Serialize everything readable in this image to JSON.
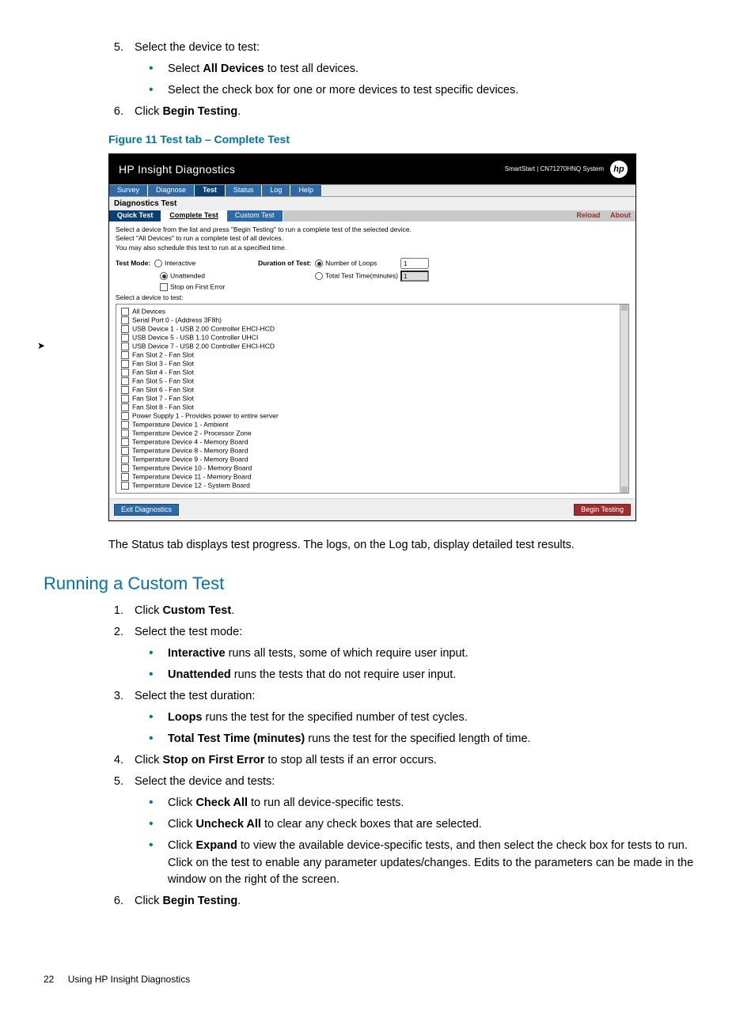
{
  "steps_top": {
    "s5": "Select the device to test:",
    "s5_b1_pre": "Select ",
    "s5_b1_bold": "All Devices",
    "s5_b1_post": " to test all devices.",
    "s5_b2": "Select the check box for one or more devices to test specific devices.",
    "s6_pre": "Click ",
    "s6_bold": "Begin Testing",
    "s6_post": "."
  },
  "figure_caption": "Figure 11 Test tab – Complete Test",
  "shot": {
    "title": "HP Insight Diagnostics",
    "sys": "SmartStart | CN71270HNQ System",
    "logo": "hp",
    "tabs": [
      "Survey",
      "Diagnose",
      "Test",
      "Status",
      "Log",
      "Help"
    ],
    "subtitle": "Diagnostics Test",
    "subtabs": [
      "Quick Test",
      "Complete Test",
      "Custom Test"
    ],
    "links": [
      "Reload",
      "About"
    ],
    "desc1": "Select a device from the list and press \"Begin Testing\" to run a complete test of the selected device.",
    "desc2": "Select \"All Devices\" to run a complete test of all devices.",
    "desc3": "You may also schedule this test to run at a specified time.",
    "testmode": "Test Mode:",
    "interactive": "Interactive",
    "unattended": "Unattended",
    "stop": "Stop on First Error",
    "duration": "Duration of Test:",
    "loops": "Number of Loops",
    "ttt": "Total Test Time(minutes)",
    "val1": "1",
    "val2": "1",
    "sel": "Select a device to test:",
    "devices": [
      "All Devices",
      "Serial Port 0 - (Address 3F8h)",
      "USB Device 1 - USB 2.00 Controller EHCI-HCD",
      "USB Device 5 - USB 1.10 Controller UHCI",
      "USB Device 7 - USB 2.00 Controller EHCI-HCD",
      "Fan Slot 2 - Fan Slot",
      "Fan Slot 3 - Fan Slot",
      "Fan Slot 4 - Fan Slot",
      "Fan Slot 5 - Fan Slot",
      "Fan Slot 6 - Fan Slot",
      "Fan Slot 7 - Fan Slot",
      "Fan Slot 8 - Fan Slot",
      "Power Supply 1 - Provides power to entire server",
      "Temperature Device 1 - Ambient",
      "Temperature Device 2 - Processor Zone",
      "Temperature Device 4 - Memory Board",
      "Temperature Device 8 - Memory Board",
      "Temperature Device 9 - Memory Board",
      "Temperature Device 10 - Memory Board",
      "Temperature Device 11 - Memory Board",
      "Temperature Device 12 - System Board"
    ],
    "exit": "Exit Diagnostics",
    "begin": "Begin Testing"
  },
  "after_figure": "The Status tab displays test progress. The logs, on the Log tab, display detailed test results.",
  "section2": "Running a Custom Test",
  "steps2": {
    "s1_pre": "Click ",
    "s1_bold": "Custom Test",
    "s1_post": ".",
    "s2": "Select the test mode:",
    "s2_b1_bold": "Interactive",
    "s2_b1_post": " runs all tests, some of which require user input.",
    "s2_b2_bold": "Unattended",
    "s2_b2_post": " runs the tests that do not require user input.",
    "s3": "Select the test duration:",
    "s3_b1_bold": "Loops",
    "s3_b1_post": " runs the test for the specified number of test cycles.",
    "s3_b2_bold": "Total Test Time (minutes)",
    "s3_b2_post": " runs the test for the specified length of time.",
    "s4_pre": "Click ",
    "s4_bold": "Stop on First Error",
    "s4_post": " to stop all tests if an error occurs.",
    "s5": "Select the device and tests:",
    "s5_b1_pre": "Click ",
    "s5_b1_bold": "Check All",
    "s5_b1_post": " to run all device-specific tests.",
    "s5_b2_pre": "Click ",
    "s5_b2_bold": "Uncheck All",
    "s5_b2_post": " to clear any check boxes that are selected.",
    "s5_b3_pre": "Click ",
    "s5_b3_bold": "Expand",
    "s5_b3_post": " to view the available device-specific tests, and then select the check box for tests to run. Click on the test to enable any parameter updates/changes. Edits to the parameters can be made in the window on the right of the screen.",
    "s6_pre": "Click ",
    "s6_bold": "Begin Testing",
    "s6_post": "."
  },
  "footer": {
    "page": "22",
    "title": "Using HP Insight Diagnostics"
  }
}
